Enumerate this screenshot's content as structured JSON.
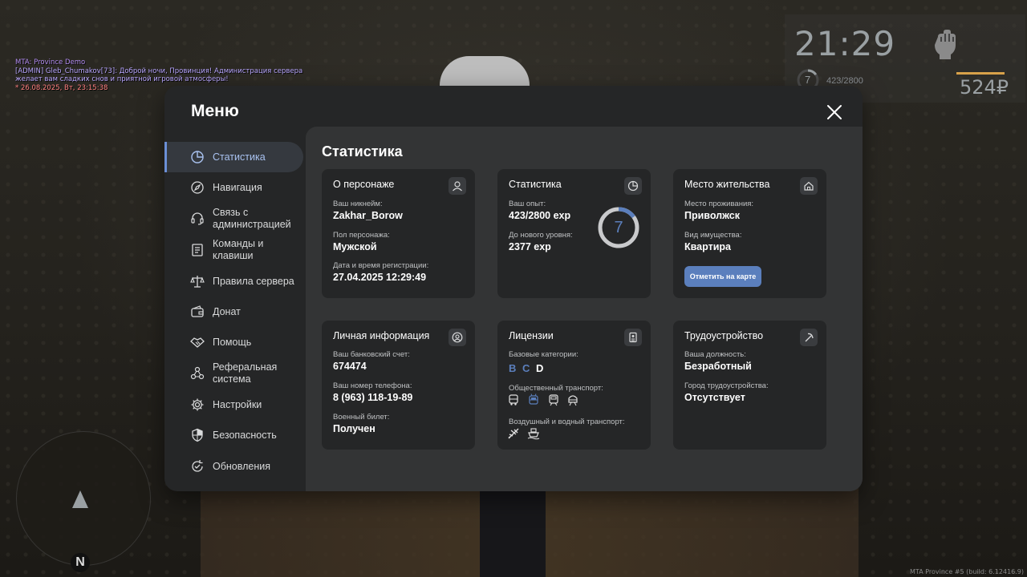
{
  "chat": {
    "line1": "MTA: Province Demo",
    "line2": "[ADMIN] Gleb_Chumakov[73]: Доброй ночи, Провинция! Администрация сервера",
    "line3": " желает вам сладких снов и приятной игровой атмосферы!",
    "line4": "* 26.08.2025, Вт, 23:15:38"
  },
  "hud": {
    "time": "21:29",
    "level": "7",
    "exp": "423/2800",
    "money": "524₽",
    "exp_progress": 0.151
  },
  "radar": {
    "north": "N"
  },
  "build": "MTA Province #5 (build: 6.12416.9)",
  "menu": {
    "title": "Меню",
    "sidebar": [
      {
        "label": "Статистика",
        "icon": "pie-chart-icon",
        "active": true
      },
      {
        "label": "Навигация",
        "icon": "compass-icon"
      },
      {
        "label": "Связь с администрацией",
        "icon": "headset-icon"
      },
      {
        "label": "Команды и клавиши",
        "icon": "document-icon"
      },
      {
        "label": "Правила сервера",
        "icon": "scales-icon"
      },
      {
        "label": "Донат",
        "icon": "wallet-icon"
      },
      {
        "label": "Помощь",
        "icon": "handshake-icon"
      },
      {
        "label": "Реферальная система",
        "icon": "referral-icon"
      },
      {
        "label": "Настройки",
        "icon": "gear-icon"
      },
      {
        "label": "Безопасность",
        "icon": "shield-icon"
      },
      {
        "label": "Обновления",
        "icon": "refresh-icon"
      }
    ],
    "content_title": "Статистика",
    "cards": {
      "character": {
        "title": "О персонаже",
        "nickname_label": "Ваш никнейм:",
        "nickname": "Zakhar_Borow",
        "gender_label": "Пол персонажа:",
        "gender": "Мужской",
        "reg_label": "Дата и время регистрации:",
        "reg_date": "27.04.2025 12:29:49"
      },
      "stats": {
        "title": "Статистика",
        "exp_label": "Ваш опыт:",
        "exp": "423/2800 exp",
        "next_label": "До нового уровня:",
        "next": "2377 exp",
        "level": "7",
        "progress": 0.151
      },
      "residence": {
        "title": "Место жительства",
        "city_label": "Место проживания:",
        "city": "Приволжск",
        "property_label": "Вид имущества:",
        "property": "Квартира",
        "map_button": "Отметить на карте"
      },
      "personal": {
        "title": "Личная информация",
        "bank_label": "Ваш банковский счет:",
        "bank": "674474",
        "phone_label": "Ваш номер телефона:",
        "phone": "8 (963) 118-19-89",
        "military_label": "Военный билет:",
        "military": "Получен"
      },
      "licenses": {
        "title": "Лицензии",
        "base_label": "Базовые категории:",
        "categories": [
          {
            "name": "B",
            "color": "#5b7fbd"
          },
          {
            "name": "C",
            "color": "#5b7fbd"
          },
          {
            "name": "D",
            "color": "#ffffff"
          }
        ],
        "public_label": "Общественный транспорт:",
        "air_water_label": "Воздушный и водный транспорт:"
      },
      "employment": {
        "title": "Трудоустройство",
        "position_label": "Ваша должность:",
        "position": "Безработный",
        "city_label": "Город трудоустройства:",
        "city": "Отсутствует"
      }
    }
  },
  "colors": {
    "accent": "#5b7fbd",
    "panel": "#252627",
    "content": "#333435"
  }
}
